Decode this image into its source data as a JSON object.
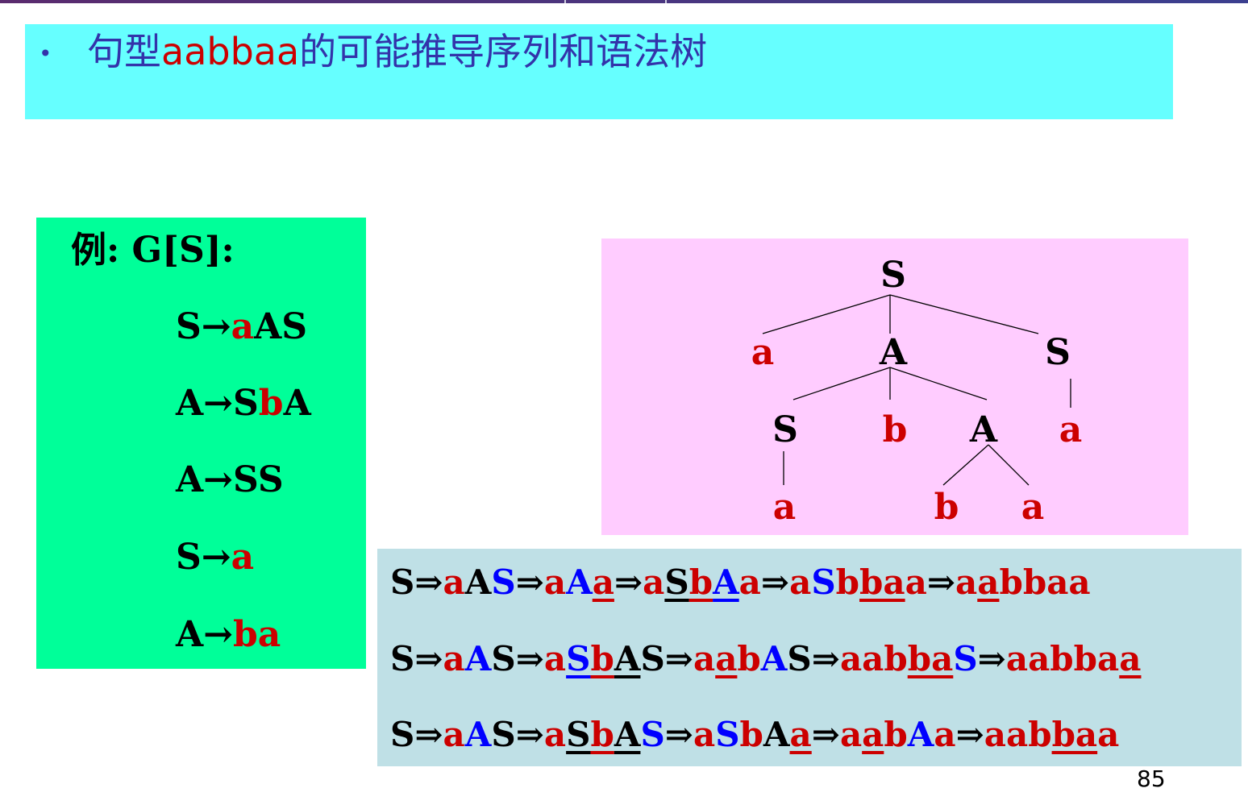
{
  "title": {
    "bullet": "•",
    "pre": "句型",
    "sentence": "aabbaa",
    "post": "的可能推导序列和语法树"
  },
  "grammar": {
    "heading": "例: G[S]:",
    "rules": [
      {
        "lhs": "S",
        "arrow": "→",
        "rhs": [
          {
            "t": "a",
            "c": "red"
          },
          {
            "t": "AS",
            "c": "black"
          }
        ]
      },
      {
        "lhs": "A",
        "arrow": "→",
        "rhs": [
          {
            "t": "S",
            "c": "black"
          },
          {
            "t": "b",
            "c": "red"
          },
          {
            "t": "A",
            "c": "black"
          }
        ]
      },
      {
        "lhs": "A",
        "arrow": "→",
        "rhs": [
          {
            "t": "SS",
            "c": "black"
          }
        ]
      },
      {
        "lhs": "S",
        "arrow": "→",
        "rhs": [
          {
            "t": "a",
            "c": "red"
          }
        ]
      },
      {
        "lhs": "A",
        "arrow": "→",
        "rhs": [
          {
            "t": "ba",
            "c": "red"
          }
        ]
      }
    ]
  },
  "tree": {
    "nodes": [
      {
        "id": "n0",
        "label": "S",
        "c": "black"
      },
      {
        "id": "n1",
        "label": "a",
        "c": "red"
      },
      {
        "id": "n2",
        "label": "A",
        "c": "black"
      },
      {
        "id": "n3",
        "label": "S",
        "c": "black"
      },
      {
        "id": "n4",
        "label": "S",
        "c": "black"
      },
      {
        "id": "n5",
        "label": "b",
        "c": "red"
      },
      {
        "id": "n6",
        "label": "A",
        "c": "black"
      },
      {
        "id": "n7",
        "label": "a",
        "c": "red"
      },
      {
        "id": "n8",
        "label": "a",
        "c": "red"
      },
      {
        "id": "n9",
        "label": "b",
        "c": "red"
      },
      {
        "id": "n10",
        "label": "a",
        "c": "red"
      }
    ],
    "edges": [
      [
        "n0",
        "n1"
      ],
      [
        "n0",
        "n2"
      ],
      [
        "n0",
        "n3"
      ],
      [
        "n2",
        "n4"
      ],
      [
        "n2",
        "n5"
      ],
      [
        "n2",
        "n6"
      ],
      [
        "n3",
        "n7"
      ],
      [
        "n4",
        "n8"
      ],
      [
        "n6",
        "n9"
      ],
      [
        "n6",
        "n10"
      ]
    ]
  },
  "derivations": [
    [
      {
        "t": "S",
        "c": "black"
      },
      {
        "t": "⇒",
        "c": "black"
      },
      {
        "t": "a",
        "c": "red"
      },
      {
        "t": "A",
        "c": "black"
      },
      {
        "t": "S",
        "c": "blue"
      },
      {
        "t": "⇒",
        "c": "black"
      },
      {
        "t": "a",
        "c": "red"
      },
      {
        "t": "A",
        "c": "blue"
      },
      {
        "t": "a",
        "c": "red",
        "u": true
      },
      {
        "t": "⇒",
        "c": "black"
      },
      {
        "t": "a",
        "c": "red"
      },
      {
        "t": "S",
        "c": "black",
        "u": true
      },
      {
        "t": "b",
        "c": "red",
        "u": true
      },
      {
        "t": "A",
        "c": "blue",
        "u": true
      },
      {
        "t": "a",
        "c": "red"
      },
      {
        "t": "⇒",
        "c": "black"
      },
      {
        "t": "a",
        "c": "red"
      },
      {
        "t": "S",
        "c": "blue"
      },
      {
        "t": "b",
        "c": "red"
      },
      {
        "t": "ba",
        "c": "red",
        "u": true
      },
      {
        "t": "a",
        "c": "red"
      },
      {
        "t": "⇒",
        "c": "black"
      },
      {
        "t": "a",
        "c": "red"
      },
      {
        "t": "a",
        "c": "red",
        "u": true
      },
      {
        "t": "bbaa",
        "c": "red"
      }
    ],
    [
      {
        "t": "S",
        "c": "black"
      },
      {
        "t": "⇒",
        "c": "black"
      },
      {
        "t": "a",
        "c": "red"
      },
      {
        "t": "A",
        "c": "blue"
      },
      {
        "t": "S",
        "c": "black"
      },
      {
        "t": "⇒",
        "c": "black"
      },
      {
        "t": "a",
        "c": "red"
      },
      {
        "t": "S",
        "c": "blue",
        "u": true
      },
      {
        "t": "b",
        "c": "red",
        "u": true
      },
      {
        "t": "A",
        "c": "black",
        "u": true
      },
      {
        "t": "S",
        "c": "black"
      },
      {
        "t": "⇒",
        "c": "black"
      },
      {
        "t": "a",
        "c": "red"
      },
      {
        "t": "a",
        "c": "red",
        "u": true
      },
      {
        "t": "b",
        "c": "red"
      },
      {
        "t": "A",
        "c": "blue"
      },
      {
        "t": "S",
        "c": "black"
      },
      {
        "t": "⇒",
        "c": "black"
      },
      {
        "t": "aab",
        "c": "red"
      },
      {
        "t": "ba",
        "c": "red",
        "u": true
      },
      {
        "t": "S",
        "c": "blue"
      },
      {
        "t": "⇒",
        "c": "black"
      },
      {
        "t": "aabba",
        "c": "red"
      },
      {
        "t": "a",
        "c": "red",
        "u": true
      }
    ],
    [
      {
        "t": "S",
        "c": "black"
      },
      {
        "t": "⇒",
        "c": "black"
      },
      {
        "t": "a",
        "c": "red"
      },
      {
        "t": "A",
        "c": "blue"
      },
      {
        "t": "S",
        "c": "black"
      },
      {
        "t": "⇒",
        "c": "black"
      },
      {
        "t": "a",
        "c": "red"
      },
      {
        "t": "S",
        "c": "black",
        "u": true
      },
      {
        "t": "b",
        "c": "red",
        "u": true
      },
      {
        "t": "A",
        "c": "black",
        "u": true
      },
      {
        "t": "S",
        "c": "blue"
      },
      {
        "t": "⇒",
        "c": "black"
      },
      {
        "t": "a",
        "c": "red"
      },
      {
        "t": "S",
        "c": "blue"
      },
      {
        "t": "b",
        "c": "red"
      },
      {
        "t": "A",
        "c": "black"
      },
      {
        "t": "a",
        "c": "red",
        "u": true
      },
      {
        "t": "⇒",
        "c": "black"
      },
      {
        "t": "a",
        "c": "red"
      },
      {
        "t": "a",
        "c": "red",
        "u": true
      },
      {
        "t": "b",
        "c": "red"
      },
      {
        "t": "A",
        "c": "blue"
      },
      {
        "t": "a",
        "c": "red"
      },
      {
        "t": "⇒",
        "c": "black"
      },
      {
        "t": "aab",
        "c": "red"
      },
      {
        "t": "ba",
        "c": "red",
        "u": true
      },
      {
        "t": "a",
        "c": "red"
      }
    ]
  ],
  "colors": {
    "red": "#cc0000",
    "blue": "#0000ff",
    "black": "#000000",
    "title_blue": "#3333aa"
  },
  "page_number": "85"
}
